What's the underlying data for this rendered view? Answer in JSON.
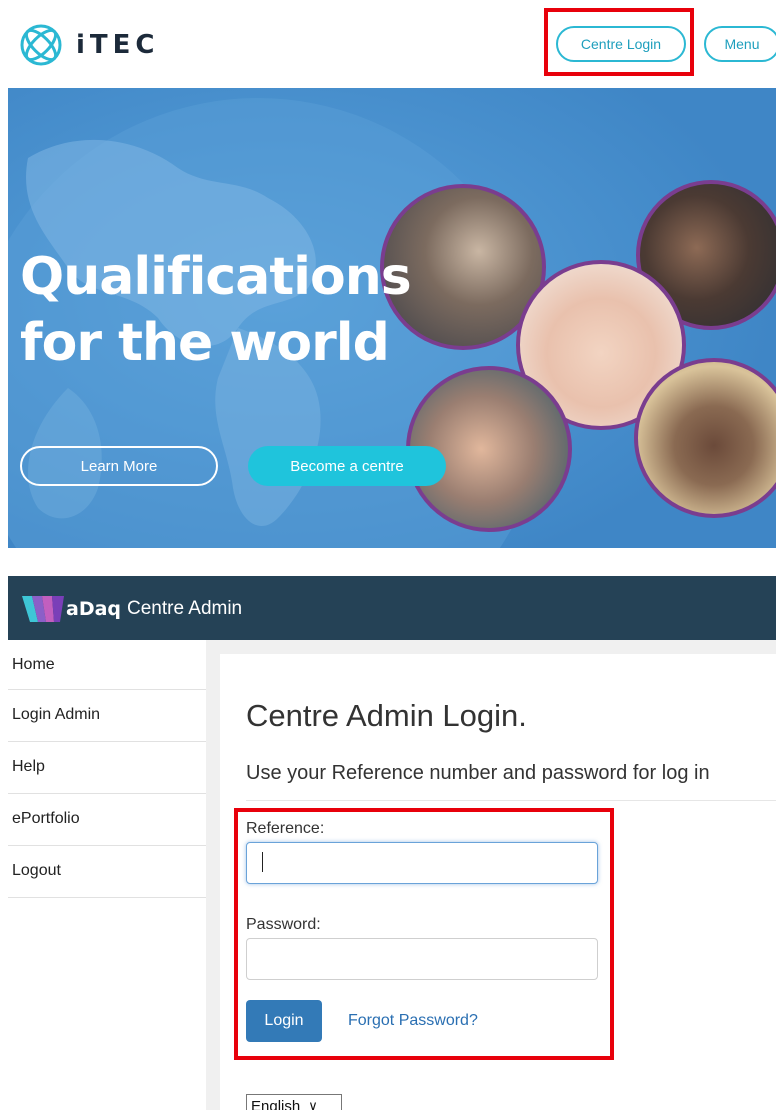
{
  "itec": {
    "brand": "iTEC",
    "centre_login_label": "Centre Login",
    "menu_label": "Menu",
    "hero_title_line1": "Qualifications",
    "hero_title_line2": "for the world",
    "learn_more_label": "Learn More",
    "become_centre_label": "Become a centre",
    "accent_color": "#2bb8d3",
    "hero_color": "#4a92cf"
  },
  "wadaq": {
    "brand": "aDaq",
    "app_title": "Centre Admin",
    "bar_color": "#254256"
  },
  "sidebar": {
    "items": [
      {
        "label": "Home"
      },
      {
        "label": "Login Admin"
      },
      {
        "label": "Help"
      },
      {
        "label": "ePortfolio"
      },
      {
        "label": "Logout"
      }
    ]
  },
  "login": {
    "title": "Centre Admin Login.",
    "subtitle": "Use your Reference number and password for log in",
    "reference_label": "Reference:",
    "reference_value": "",
    "password_label": "Password:",
    "password_value": "",
    "login_button_label": "Login",
    "forgot_label": "Forgot Password?",
    "button_color": "#337ab7"
  },
  "language": {
    "selected": "English"
  },
  "highlight_color": "#e8000b"
}
